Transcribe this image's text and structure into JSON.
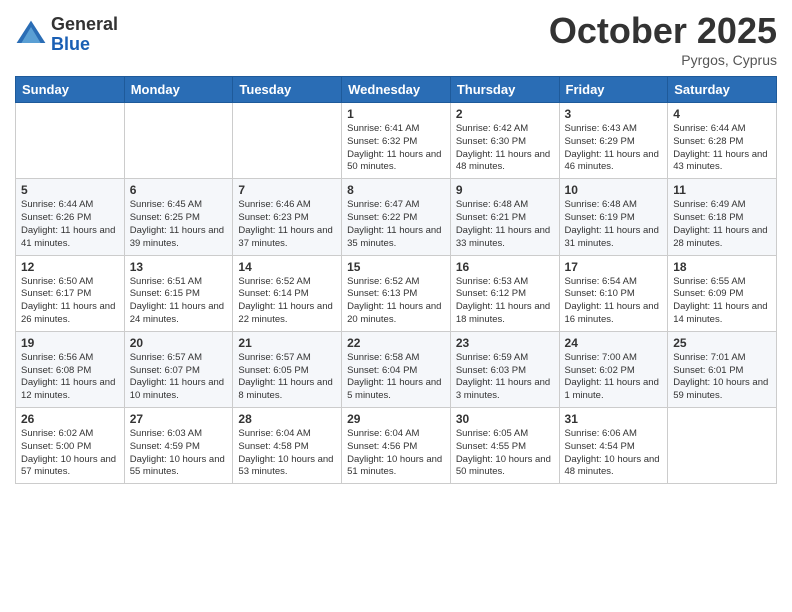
{
  "header": {
    "logo_general": "General",
    "logo_blue": "Blue",
    "month_title": "October 2025",
    "subtitle": "Pyrgos, Cyprus"
  },
  "weekdays": [
    "Sunday",
    "Monday",
    "Tuesday",
    "Wednesday",
    "Thursday",
    "Friday",
    "Saturday"
  ],
  "weeks": [
    [
      {
        "day": "",
        "info": ""
      },
      {
        "day": "",
        "info": ""
      },
      {
        "day": "",
        "info": ""
      },
      {
        "day": "1",
        "info": "Sunrise: 6:41 AM\nSunset: 6:32 PM\nDaylight: 11 hours and 50 minutes."
      },
      {
        "day": "2",
        "info": "Sunrise: 6:42 AM\nSunset: 6:30 PM\nDaylight: 11 hours and 48 minutes."
      },
      {
        "day": "3",
        "info": "Sunrise: 6:43 AM\nSunset: 6:29 PM\nDaylight: 11 hours and 46 minutes."
      },
      {
        "day": "4",
        "info": "Sunrise: 6:44 AM\nSunset: 6:28 PM\nDaylight: 11 hours and 43 minutes."
      }
    ],
    [
      {
        "day": "5",
        "info": "Sunrise: 6:44 AM\nSunset: 6:26 PM\nDaylight: 11 hours and 41 minutes."
      },
      {
        "day": "6",
        "info": "Sunrise: 6:45 AM\nSunset: 6:25 PM\nDaylight: 11 hours and 39 minutes."
      },
      {
        "day": "7",
        "info": "Sunrise: 6:46 AM\nSunset: 6:23 PM\nDaylight: 11 hours and 37 minutes."
      },
      {
        "day": "8",
        "info": "Sunrise: 6:47 AM\nSunset: 6:22 PM\nDaylight: 11 hours and 35 minutes."
      },
      {
        "day": "9",
        "info": "Sunrise: 6:48 AM\nSunset: 6:21 PM\nDaylight: 11 hours and 33 minutes."
      },
      {
        "day": "10",
        "info": "Sunrise: 6:48 AM\nSunset: 6:19 PM\nDaylight: 11 hours and 31 minutes."
      },
      {
        "day": "11",
        "info": "Sunrise: 6:49 AM\nSunset: 6:18 PM\nDaylight: 11 hours and 28 minutes."
      }
    ],
    [
      {
        "day": "12",
        "info": "Sunrise: 6:50 AM\nSunset: 6:17 PM\nDaylight: 11 hours and 26 minutes."
      },
      {
        "day": "13",
        "info": "Sunrise: 6:51 AM\nSunset: 6:15 PM\nDaylight: 11 hours and 24 minutes."
      },
      {
        "day": "14",
        "info": "Sunrise: 6:52 AM\nSunset: 6:14 PM\nDaylight: 11 hours and 22 minutes."
      },
      {
        "day": "15",
        "info": "Sunrise: 6:52 AM\nSunset: 6:13 PM\nDaylight: 11 hours and 20 minutes."
      },
      {
        "day": "16",
        "info": "Sunrise: 6:53 AM\nSunset: 6:12 PM\nDaylight: 11 hours and 18 minutes."
      },
      {
        "day": "17",
        "info": "Sunrise: 6:54 AM\nSunset: 6:10 PM\nDaylight: 11 hours and 16 minutes."
      },
      {
        "day": "18",
        "info": "Sunrise: 6:55 AM\nSunset: 6:09 PM\nDaylight: 11 hours and 14 minutes."
      }
    ],
    [
      {
        "day": "19",
        "info": "Sunrise: 6:56 AM\nSunset: 6:08 PM\nDaylight: 11 hours and 12 minutes."
      },
      {
        "day": "20",
        "info": "Sunrise: 6:57 AM\nSunset: 6:07 PM\nDaylight: 11 hours and 10 minutes."
      },
      {
        "day": "21",
        "info": "Sunrise: 6:57 AM\nSunset: 6:05 PM\nDaylight: 11 hours and 8 minutes."
      },
      {
        "day": "22",
        "info": "Sunrise: 6:58 AM\nSunset: 6:04 PM\nDaylight: 11 hours and 5 minutes."
      },
      {
        "day": "23",
        "info": "Sunrise: 6:59 AM\nSunset: 6:03 PM\nDaylight: 11 hours and 3 minutes."
      },
      {
        "day": "24",
        "info": "Sunrise: 7:00 AM\nSunset: 6:02 PM\nDaylight: 11 hours and 1 minute."
      },
      {
        "day": "25",
        "info": "Sunrise: 7:01 AM\nSunset: 6:01 PM\nDaylight: 10 hours and 59 minutes."
      }
    ],
    [
      {
        "day": "26",
        "info": "Sunrise: 6:02 AM\nSunset: 5:00 PM\nDaylight: 10 hours and 57 minutes."
      },
      {
        "day": "27",
        "info": "Sunrise: 6:03 AM\nSunset: 4:59 PM\nDaylight: 10 hours and 55 minutes."
      },
      {
        "day": "28",
        "info": "Sunrise: 6:04 AM\nSunset: 4:58 PM\nDaylight: 10 hours and 53 minutes."
      },
      {
        "day": "29",
        "info": "Sunrise: 6:04 AM\nSunset: 4:56 PM\nDaylight: 10 hours and 51 minutes."
      },
      {
        "day": "30",
        "info": "Sunrise: 6:05 AM\nSunset: 4:55 PM\nDaylight: 10 hours and 50 minutes."
      },
      {
        "day": "31",
        "info": "Sunrise: 6:06 AM\nSunset: 4:54 PM\nDaylight: 10 hours and 48 minutes."
      },
      {
        "day": "",
        "info": ""
      }
    ]
  ]
}
